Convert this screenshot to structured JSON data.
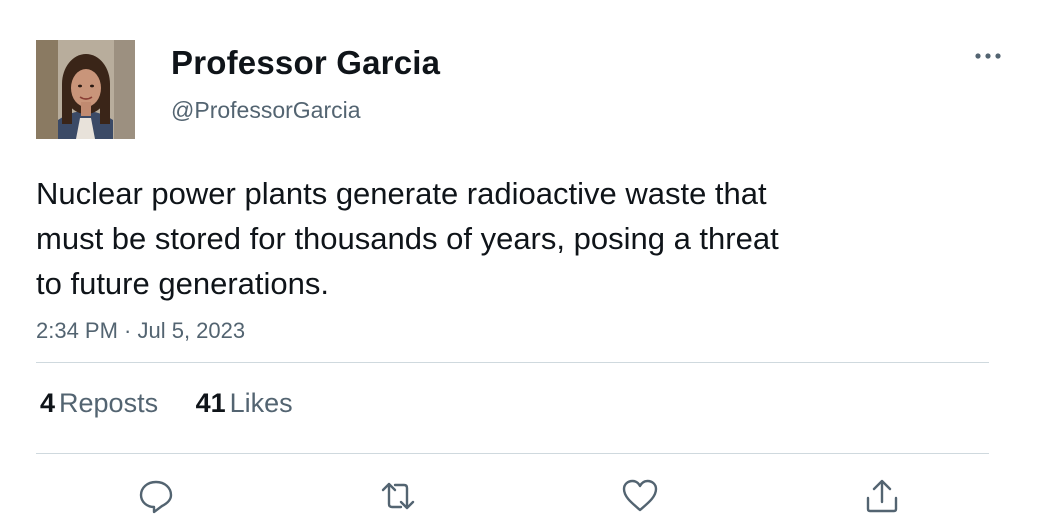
{
  "author": {
    "display_name": "Professor Garcia",
    "handle": "@ProfessorGarcia",
    "avatar_icon": "profile-photo"
  },
  "tweet": {
    "text_lines": [
      "Nuclear power plants generate radioactive waste that",
      "must be stored for thousands of years, posing a threat",
      "to future generations."
    ],
    "timestamp": "2:34 PM · Jul 5, 2023"
  },
  "stats": {
    "reposts_count": "4",
    "reposts_label": "Reposts",
    "likes_count": "41",
    "likes_label": "Likes"
  },
  "actions": {
    "reply_icon": "reply-icon",
    "repost_icon": "repost-icon",
    "like_icon": "heart-icon",
    "share_icon": "share-icon",
    "more_icon": "more-icon"
  },
  "colors": {
    "text_primary": "#0f1419",
    "text_secondary": "#536471",
    "divider": "#cfd9de",
    "background": "#ffffff"
  }
}
